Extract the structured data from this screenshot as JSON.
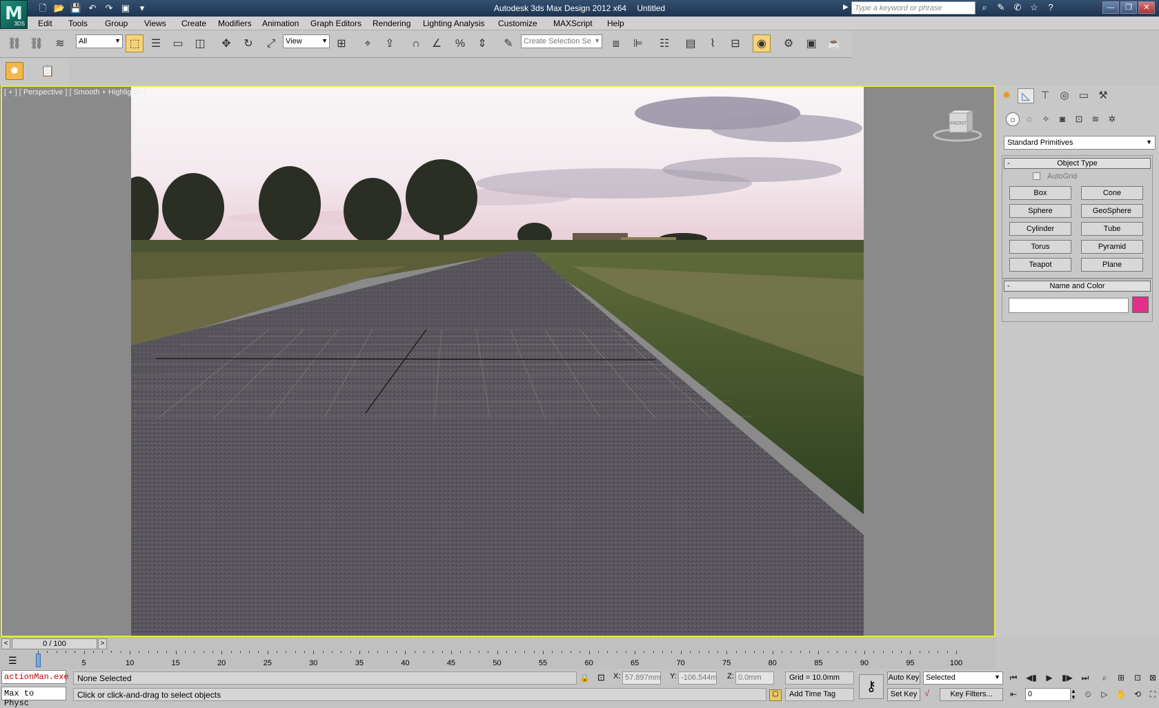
{
  "app": {
    "title": "Autodesk 3ds Max Design 2012 x64",
    "document": "Untitled",
    "logo_text": "3DS",
    "logo_letter": "M",
    "search_placeholder": "Type a keyword or phrase"
  },
  "menu": [
    "Edit",
    "Tools",
    "Group",
    "Views",
    "Create",
    "Modifiers",
    "Animation",
    "Graph Editors",
    "Rendering",
    "Lighting Analysis",
    "Customize",
    "MAXScript",
    "Help"
  ],
  "toolbar": {
    "selection_filter": "All",
    "reference_coord": "View",
    "named_selection_placeholder": "Create Selection Se"
  },
  "viewport": {
    "label": "[ + ] [ Perspective ] [ Smooth + Highlights ]",
    "viewcube_face": "FRONT"
  },
  "command_panel": {
    "category": "Standard Primitives",
    "object_type_title": "Object Type",
    "autogrid_label": "AutoGrid",
    "buttons": [
      "Box",
      "Cone",
      "Sphere",
      "GeoSphere",
      "Cylinder",
      "Tube",
      "Torus",
      "Pyramid",
      "Teapot",
      "Plane"
    ],
    "name_color_title": "Name and Color",
    "object_color": "#e0308a"
  },
  "timeline": {
    "frame_display": "0 / 100",
    "ticks": [
      "0",
      "5",
      "10",
      "15",
      "20",
      "25",
      "30",
      "35",
      "40",
      "45",
      "50",
      "55",
      "60",
      "65",
      "70",
      "75",
      "80",
      "85",
      "90",
      "95",
      "100"
    ]
  },
  "status": {
    "maxscript_line1": "actionMan.exe",
    "maxscript_line2": "Max to Physc",
    "selection": "None Selected",
    "prompt": "Click or click-and-drag to select objects",
    "x_label": "X:",
    "x_value": "57.897mm",
    "y_label": "Y:",
    "y_value": "-106.544m",
    "z_label": "Z:",
    "z_value": "0.0mm",
    "grid": "Grid = 10.0mm",
    "add_time_tag": "Add Time Tag",
    "auto_key": "Auto Key",
    "set_key": "Set Key",
    "key_mode": "Selected",
    "key_filters": "Key Filters...",
    "current_frame": "0"
  }
}
